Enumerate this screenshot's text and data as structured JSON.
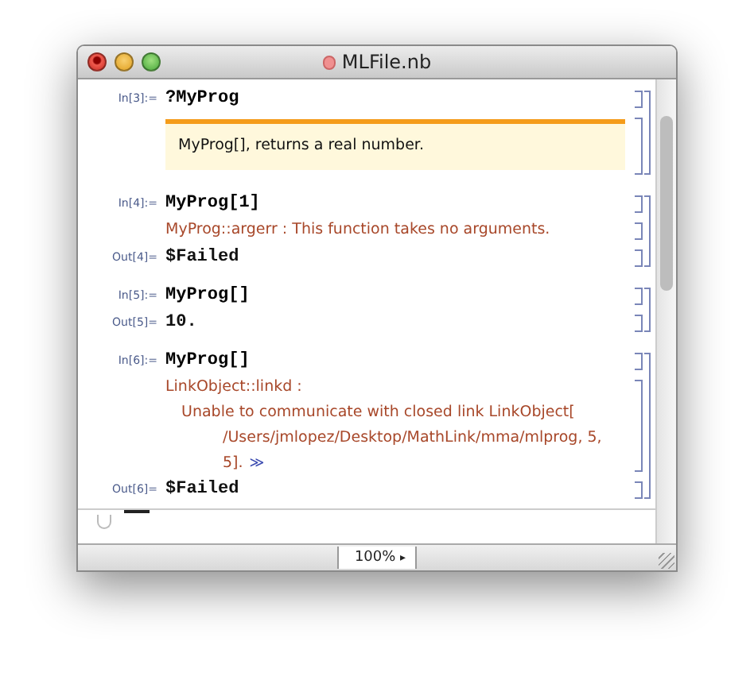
{
  "window": {
    "title": "MLFile.nb"
  },
  "groups": [
    {
      "lines": [
        {
          "kind": "input",
          "label": "In[3]:=",
          "text": "?MyProg"
        },
        {
          "kind": "usage",
          "text": "MyProg[], returns a real number."
        }
      ]
    },
    {
      "lines": [
        {
          "kind": "input",
          "label": "In[4]:=",
          "text": "MyProg[1]"
        },
        {
          "kind": "message",
          "title": "MyProg::argerr : This function takes no arguments."
        },
        {
          "kind": "output",
          "label": "Out[4]=",
          "text": "$Failed"
        }
      ]
    },
    {
      "lines": [
        {
          "kind": "input",
          "label": "In[5]:=",
          "text": "MyProg[]"
        },
        {
          "kind": "output",
          "label": "Out[5]=",
          "text": "10."
        }
      ]
    },
    {
      "lines": [
        {
          "kind": "input",
          "label": "In[6]:=",
          "text": "MyProg[]"
        },
        {
          "kind": "message",
          "title": "LinkObject::linkd :",
          "body": [
            "Unable to communicate with closed link LinkObject[",
            "/Users/jmlopez/Desktop/MathLink/mma/mlprog, 5,",
            "5]."
          ],
          "more": "≫"
        },
        {
          "kind": "output",
          "label": "Out[6]=",
          "text": "$Failed"
        }
      ]
    }
  ],
  "status_bar": {
    "zoom": "100%",
    "zoom_arrow": "▸"
  }
}
